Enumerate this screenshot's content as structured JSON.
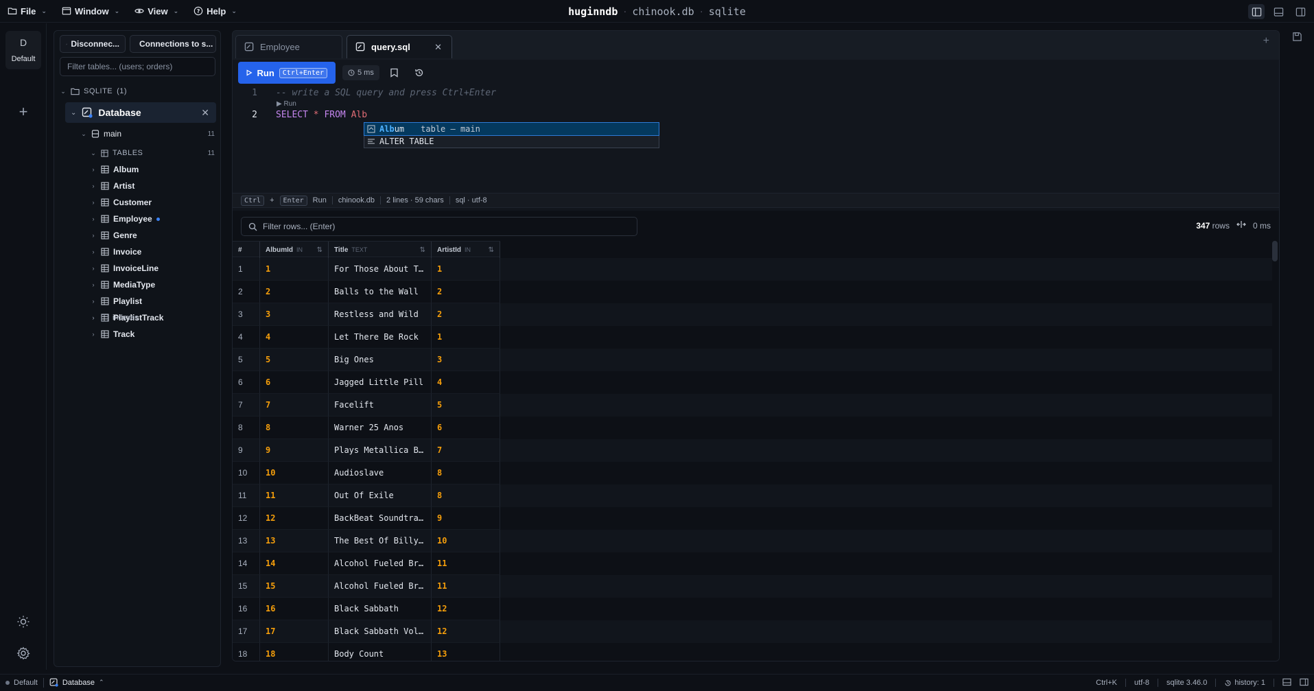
{
  "menubar": {
    "items": [
      {
        "label": "File",
        "icon": "folder-icon"
      },
      {
        "label": "Window",
        "icon": "window-icon"
      },
      {
        "label": "View",
        "icon": "eye-icon"
      },
      {
        "label": "Help",
        "icon": "help-circle-icon"
      }
    ]
  },
  "title": {
    "app": "huginndb",
    "sep1": "·",
    "db": "chinook.db",
    "sep2": "·",
    "engine": "sqlite"
  },
  "activity": {
    "workspace_letter": "D",
    "workspace_label": "Default"
  },
  "sidebar": {
    "disconnect_label": "Disconnec...",
    "connections_label": "Connections to s...",
    "filter_placeholder": "Filter tables... (users; orders)",
    "group_label": "SQLITE",
    "group_count": "(1)",
    "database_label": "Database",
    "schema_label": "main",
    "schema_count": "11",
    "tables_label": "TABLES",
    "tables_count": "11",
    "tables": [
      "Album",
      "Artist",
      "Customer",
      "Employee",
      "Genre",
      "Invoice",
      "InvoiceLine",
      "MediaType",
      "Playlist",
      "PlaylistTrack",
      "Track"
    ],
    "indexes_label": "indexes"
  },
  "tabs": [
    {
      "label": "Employee"
    },
    {
      "label": "query.sql"
    }
  ],
  "toolbar": {
    "run_label": "Run",
    "run_shortcut": "Ctrl+Enter",
    "time": "5 ms"
  },
  "editor": {
    "lines": [
      "1",
      "2"
    ],
    "comment": "-- write a SQL query and press Ctrl+Enter",
    "codelens": "▶ Run",
    "select_kw": "SELECT",
    "star": "*",
    "from_kw": "FROM",
    "partial": "Alb",
    "suggestions": [
      {
        "match": "Alb",
        "rest": "um",
        "detail": "table — main"
      },
      {
        "label": "ALTER TABLE"
      }
    ]
  },
  "editor_status": {
    "key1": "Ctrl",
    "plus": "+",
    "key2": "Enter",
    "action": "Run",
    "db": "chinook.db",
    "lines": "2 lines · 59 chars",
    "lang": "sql · utf-8"
  },
  "results": {
    "filter_placeholder": "Filter rows... (Enter)",
    "row_count": "347",
    "rows_label": "rows",
    "time": "0 ms",
    "columns": [
      {
        "name": "#",
        "type": ""
      },
      {
        "name": "AlbumId",
        "type": "IN"
      },
      {
        "name": "Title",
        "type": "TEXT"
      },
      {
        "name": "ArtistId",
        "type": "IN"
      }
    ],
    "rows": [
      [
        "1",
        "1",
        "For Those About T…",
        "1"
      ],
      [
        "2",
        "2",
        "Balls to the Wall",
        "2"
      ],
      [
        "3",
        "3",
        "Restless and Wild",
        "2"
      ],
      [
        "4",
        "4",
        "Let There Be Rock",
        "1"
      ],
      [
        "5",
        "5",
        "Big Ones",
        "3"
      ],
      [
        "6",
        "6",
        "Jagged Little Pill",
        "4"
      ],
      [
        "7",
        "7",
        "Facelift",
        "5"
      ],
      [
        "8",
        "8",
        "Warner 25 Anos",
        "6"
      ],
      [
        "9",
        "9",
        "Plays Metallica B…",
        "7"
      ],
      [
        "10",
        "10",
        "Audioslave",
        "8"
      ],
      [
        "11",
        "11",
        "Out Of Exile",
        "8"
      ],
      [
        "12",
        "12",
        "BackBeat Soundtra…",
        "9"
      ],
      [
        "13",
        "13",
        "The Best Of Billy…",
        "10"
      ],
      [
        "14",
        "14",
        "Alcohol Fueled Br…",
        "11"
      ],
      [
        "15",
        "15",
        "Alcohol Fueled Br…",
        "11"
      ],
      [
        "16",
        "16",
        "Black Sabbath",
        "12"
      ],
      [
        "17",
        "17",
        "Black Sabbath Vol…",
        "12"
      ],
      [
        "18",
        "18",
        "Body Count",
        "13"
      ]
    ]
  },
  "statusbar": {
    "workspace": "Default",
    "database": "Database",
    "shortcut": "Ctrl+K",
    "encoding": "utf-8",
    "version": "sqlite 3.46.0",
    "history": "history: 1"
  },
  "colors": {
    "accent": "#2563eb",
    "number": "#f59e0b",
    "keyword": "#c586ef",
    "identifier": "#e06c75"
  }
}
